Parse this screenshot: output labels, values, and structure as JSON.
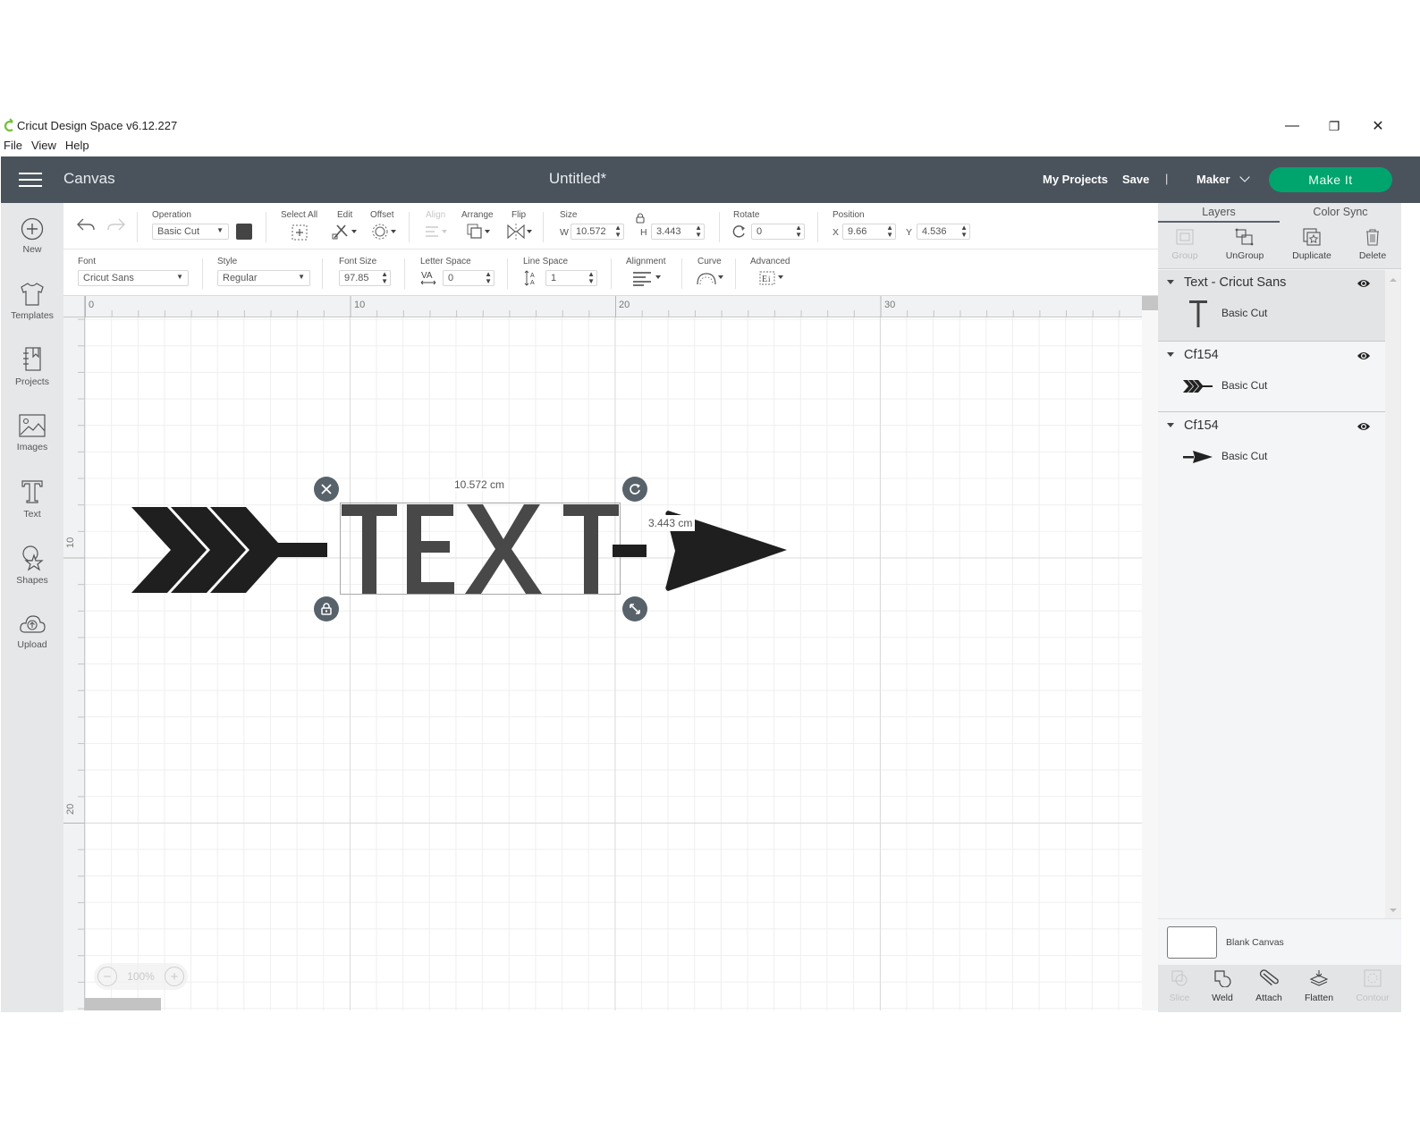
{
  "window": {
    "title": "Cricut Design Space  v6.12.227",
    "controls": {
      "minimize": "—",
      "restore": "❐",
      "close": "✕"
    },
    "menu": [
      "File",
      "View",
      "Help"
    ]
  },
  "header": {
    "section": "Canvas",
    "document_title": "Untitled*",
    "my_projects": "My Projects",
    "save": "Save",
    "separator": "|",
    "machine": "Maker",
    "make_it": "Make It",
    "accent_color": "#00a46d",
    "bar_color": "#4a535c"
  },
  "sidebar": {
    "items": [
      {
        "label": "New",
        "icon": "plus-circle-icon"
      },
      {
        "label": "Templates",
        "icon": "tshirt-icon"
      },
      {
        "label": "Projects",
        "icon": "notebook-icon"
      },
      {
        "label": "Images",
        "icon": "image-icon"
      },
      {
        "label": "Text",
        "icon": "text-icon"
      },
      {
        "label": "Shapes",
        "icon": "shapes-icon"
      },
      {
        "label": "Upload",
        "icon": "cloud-upload-icon"
      }
    ]
  },
  "toolbar": {
    "operation": {
      "label": "Operation",
      "value": "Basic Cut",
      "color": "#444444"
    },
    "select_all": "Select All",
    "edit": "Edit",
    "offset": "Offset",
    "align": "Align",
    "arrange": "Arrange",
    "flip": "Flip",
    "size": {
      "label": "Size",
      "w_label": "W",
      "w": "10.572",
      "h_label": "H",
      "h": "3.443"
    },
    "rotate": {
      "label": "Rotate",
      "value": "0"
    },
    "position": {
      "label": "Position",
      "x_label": "X",
      "x": "9.66",
      "y_label": "Y",
      "y": "4.536"
    }
  },
  "text_toolbar": {
    "font": {
      "label": "Font",
      "value": "Cricut Sans"
    },
    "style": {
      "label": "Style",
      "value": "Regular"
    },
    "font_size": {
      "label": "Font Size",
      "value": "97.85"
    },
    "letter_space": {
      "label": "Letter Space",
      "value": "0"
    },
    "line_space": {
      "label": "Line Space",
      "value": "1"
    },
    "alignment": "Alignment",
    "curve": "Curve",
    "advanced": "Advanced"
  },
  "canvas": {
    "ruler_top": [
      "0",
      "10",
      "20",
      "30"
    ],
    "ruler_left": [
      "10",
      "20"
    ],
    "text_object": "TEXT",
    "width_label": "10.572 cm",
    "height_label": "3.443 cm",
    "zoom": "100%",
    "zoom_out": "−",
    "zoom_in": "+"
  },
  "panel": {
    "tabs": [
      "Layers",
      "Color Sync"
    ],
    "active_tab": "Layers",
    "actions": [
      {
        "label": "Group",
        "enabled": false
      },
      {
        "label": "UnGroup",
        "enabled": true
      },
      {
        "label": "Duplicate",
        "enabled": true
      },
      {
        "label": "Delete",
        "enabled": true
      }
    ],
    "layers": [
      {
        "name": "Text - Cricut Sans",
        "operation": "Basic Cut",
        "thumb": "T",
        "selected": true,
        "visible": true
      },
      {
        "name": "Cf154",
        "operation": "Basic Cut",
        "thumb": "arrow-tail",
        "selected": false,
        "visible": true
      },
      {
        "name": "Cf154",
        "operation": "Basic Cut",
        "thumb": "arrow-head",
        "selected": false,
        "visible": true
      }
    ],
    "blank_canvas": "Blank Canvas",
    "bottom_actions": [
      {
        "label": "Slice",
        "enabled": false
      },
      {
        "label": "Weld",
        "enabled": true
      },
      {
        "label": "Attach",
        "enabled": true
      },
      {
        "label": "Flatten",
        "enabled": true
      },
      {
        "label": "Contour",
        "enabled": false
      }
    ]
  }
}
